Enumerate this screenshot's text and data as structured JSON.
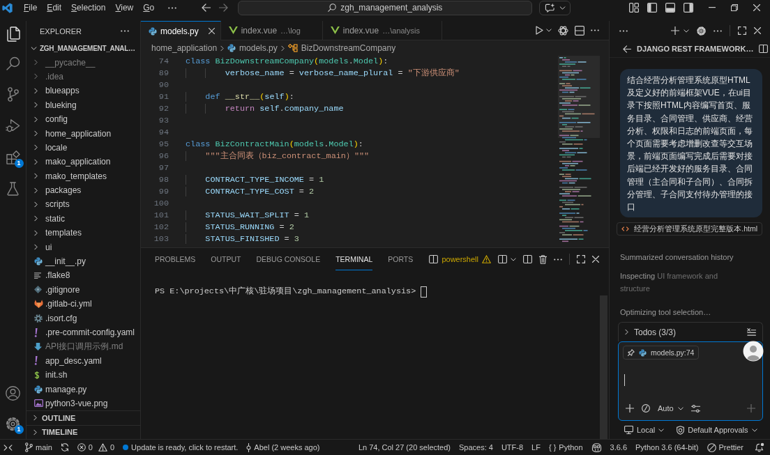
{
  "title_bar": {
    "menus": [
      "File",
      "Edit",
      "Selection",
      "View",
      "Go"
    ],
    "search": "zgh_management_analysis"
  },
  "activity_bar": {
    "items": [
      {
        "kind": "explorer",
        "selected": true
      },
      {
        "kind": "search",
        "selected": false
      },
      {
        "kind": "source_control",
        "selected": false
      },
      {
        "kind": "run_debug",
        "selected": false
      },
      {
        "kind": "extensions",
        "selected": false,
        "badge": "1"
      },
      {
        "kind": "testing",
        "selected": false
      }
    ],
    "bottom": [
      {
        "kind": "accounts"
      },
      {
        "kind": "manage",
        "badge": "1"
      }
    ]
  },
  "explorer": {
    "title": "EXPLORER",
    "root": {
      "name": "ZGH_MANAGEMENT_ANAL…",
      "expanded": true,
      "children": [
        {
          "name": "__pycache__",
          "kind": "folder",
          "expanded": false,
          "dimmed": true
        },
        {
          "name": ".idea",
          "kind": "folder",
          "expanded": false,
          "dimmed": true
        },
        {
          "name": "blueapps",
          "kind": "folder",
          "expanded": false,
          "dimmed": false
        },
        {
          "name": "blueking",
          "kind": "folder",
          "expanded": false,
          "dimmed": false
        },
        {
          "name": "config",
          "kind": "folder",
          "expanded": false,
          "dimmed": false
        },
        {
          "name": "home_application",
          "kind": "folder",
          "expanded": false,
          "dimmed": false
        },
        {
          "name": "locale",
          "kind": "folder",
          "expanded": false,
          "dimmed": false
        },
        {
          "name": "mako_application",
          "kind": "folder",
          "expanded": false,
          "dimmed": false
        },
        {
          "name": "mako_templates",
          "kind": "folder",
          "expanded": false,
          "dimmed": false
        },
        {
          "name": "packages",
          "kind": "folder",
          "expanded": false,
          "dimmed": false
        },
        {
          "name": "scripts",
          "kind": "folder",
          "expanded": false,
          "dimmed": false
        },
        {
          "name": "static",
          "kind": "folder",
          "expanded": false,
          "dimmed": false
        },
        {
          "name": "templates",
          "kind": "folder",
          "expanded": false,
          "dimmed": false
        },
        {
          "name": "ui",
          "kind": "folder",
          "expanded": false,
          "dimmed": false
        },
        {
          "name": "__init__.py",
          "kind": "python",
          "dimmed": false
        },
        {
          "name": ".flake8",
          "kind": "lines",
          "dimmed": false
        },
        {
          "name": ".gitignore",
          "kind": "git",
          "dimmed": false
        },
        {
          "name": ".gitlab-ci.yml",
          "kind": "gitlab",
          "dimmed": false
        },
        {
          "name": ".isort.cfg",
          "kind": "config",
          "dimmed": false
        },
        {
          "name": ".pre-commit-config.yaml",
          "kind": "yaml",
          "dimmed": false
        },
        {
          "name": "API接口调用示例.md",
          "kind": "markdown",
          "dimmed": true
        },
        {
          "name": "app_desc.yaml",
          "kind": "yaml",
          "dimmed": false
        },
        {
          "name": "init.sh",
          "kind": "shell",
          "dimmed": false
        },
        {
          "name": "manage.py",
          "kind": "python",
          "dimmed": false
        },
        {
          "name": "python3-vue.png",
          "kind": "image",
          "dimmed": false
        }
      ]
    },
    "sections": [
      {
        "name": "OUTLINE",
        "expanded": false
      },
      {
        "name": "TIMELINE",
        "expanded": false
      }
    ]
  },
  "editor": {
    "tabs": [
      {
        "label": "models.py",
        "kind": "python",
        "selected": true
      },
      {
        "label": "index.vue",
        "description": "…\\log",
        "kind": "vue",
        "selected": false
      },
      {
        "label": "index.vue",
        "description": "…\\analysis",
        "kind": "vue",
        "selected": false
      }
    ],
    "breadcrumbs": [
      {
        "label": "home_application",
        "kind": "folder"
      },
      {
        "label": "models.py",
        "kind": "python"
      },
      {
        "label": "BizDownstreamCompany",
        "kind": "class"
      }
    ],
    "lines": [
      {
        "number": "74",
        "tokens": [
          {
            "text": "class ",
            "kind": "keyword"
          },
          {
            "text": "BizDownstreamCompany",
            "kind": "type"
          },
          {
            "text": "(",
            "kind": "bracket"
          },
          {
            "text": "models",
            "kind": "type"
          },
          {
            "text": ".",
            "kind": "plain"
          },
          {
            "text": "Model",
            "kind": "type"
          },
          {
            "text": ")",
            "kind": "bracket"
          },
          {
            "text": ":",
            "kind": "plain"
          }
        ]
      },
      {
        "number": "89",
        "tokens": [
          {
            "text": "        verbose_name",
            "kind": "variable"
          },
          {
            "text": " = ",
            "kind": "plain"
          },
          {
            "text": "verbose_name_plural",
            "kind": "variable"
          },
          {
            "text": " = ",
            "kind": "plain"
          },
          {
            "text": "\"下游供应商\"",
            "kind": "string"
          }
        ]
      },
      {
        "number": "90"
      },
      {
        "number": "91",
        "tokens": [
          {
            "text": "    def ",
            "kind": "keyword"
          },
          {
            "text": "__str__",
            "kind": "function"
          },
          {
            "text": "(",
            "kind": "bracket"
          },
          {
            "text": "self",
            "kind": "variable"
          },
          {
            "text": ")",
            "kind": "bracket"
          },
          {
            "text": ":",
            "kind": "plain"
          }
        ]
      },
      {
        "number": "92",
        "tokens": [
          {
            "text": "        return ",
            "kind": "control"
          },
          {
            "text": "self",
            "kind": "variable"
          },
          {
            "text": ".",
            "kind": "plain"
          },
          {
            "text": "company_name",
            "kind": "variable"
          }
        ]
      },
      {
        "number": "93"
      },
      {
        "number": "94"
      },
      {
        "number": "95",
        "tokens": [
          {
            "text": "class ",
            "kind": "keyword"
          },
          {
            "text": "BizContractMain",
            "kind": "type"
          },
          {
            "text": "(",
            "kind": "bracket"
          },
          {
            "text": "models",
            "kind": "type"
          },
          {
            "text": ".",
            "kind": "plain"
          },
          {
            "text": "Model",
            "kind": "type"
          },
          {
            "text": ")",
            "kind": "bracket"
          },
          {
            "text": ":",
            "kind": "plain"
          }
        ]
      },
      {
        "number": "96",
        "tokens": [
          {
            "text": "    \"\"\"主合同表（biz_contract_main）\"\"\"",
            "kind": "string"
          }
        ]
      },
      {
        "number": "97"
      },
      {
        "number": "98",
        "tokens": [
          {
            "text": "    CONTRACT_TYPE_INCOME",
            "kind": "variable"
          },
          {
            "text": " = ",
            "kind": "plain"
          },
          {
            "text": "1",
            "kind": "number"
          }
        ]
      },
      {
        "number": "99",
        "tokens": [
          {
            "text": "    CONTRACT_TYPE_COST",
            "kind": "variable"
          },
          {
            "text": " = ",
            "kind": "plain"
          },
          {
            "text": "2",
            "kind": "number"
          }
        ]
      },
      {
        "number": "100"
      },
      {
        "number": "101",
        "tokens": [
          {
            "text": "    STATUS_WAIT_SPLIT",
            "kind": "variable"
          },
          {
            "text": " = ",
            "kind": "plain"
          },
          {
            "text": "1",
            "kind": "number"
          }
        ]
      },
      {
        "number": "102",
        "tokens": [
          {
            "text": "    STATUS_RUNNING",
            "kind": "variable"
          },
          {
            "text": " = ",
            "kind": "plain"
          },
          {
            "text": "2",
            "kind": "number"
          }
        ]
      },
      {
        "number": "103",
        "tokens": [
          {
            "text": "    STATUS_FINISHED",
            "kind": "variable"
          },
          {
            "text": " = ",
            "kind": "plain"
          },
          {
            "text": "3",
            "kind": "number"
          }
        ]
      }
    ]
  },
  "panel": {
    "tabs": [
      {
        "label": "PROBLEMS",
        "selected": false
      },
      {
        "label": "OUTPUT",
        "selected": false
      },
      {
        "label": "DEBUG CONSOLE",
        "selected": false
      },
      {
        "label": "TERMINAL",
        "selected": true
      },
      {
        "label": "PORTS",
        "selected": false
      }
    ],
    "terminal": {
      "shell": "powershell",
      "warning": true,
      "prompt": "PS E:\\projects\\中广核\\驻场项目\\zgh_management_analysis>"
    }
  },
  "chat": {
    "title": "DJANGO REST FRAMEWORK…",
    "message": "结合经营分析管理系统原型HTML及定义好的前端框架VUE，在ui目录下按照HTML内容编写首页、服务目录、合同管理、供应商、经营分析、权限和日志的前端页面，每个页面需要考虑增删改查等交互场景，前端页面编写完成后需要对接后端已经开发好的服务目录、合同管理（主合同和子合同）、合同拆分管理、子合同支付待办管理的接口",
    "attachment": "经营分析管理系统原型完整版本.html",
    "progress": [
      {
        "text": "Summarized conversation history"
      },
      {
        "text": "Inspecting",
        "detail": "UI framework and structure"
      },
      {
        "text": "Optimizing tool selection…"
      }
    ],
    "todos": {
      "label": "Todos (3/3)",
      "expanded": false
    },
    "input": {
      "context": "models.py:74",
      "mode": "Auto"
    },
    "footer": [
      {
        "kind": "local",
        "label": "Local"
      },
      {
        "kind": "approvals",
        "label": "Default Approvals"
      }
    ]
  },
  "status_bar": {
    "left": [
      {
        "kind": "remote"
      },
      {
        "kind": "branch",
        "label": "main"
      },
      {
        "kind": "sync"
      },
      {
        "kind": "problems",
        "errors": "0",
        "warnings": "0"
      },
      {
        "kind": "update",
        "label": "Update is ready, click to restart."
      },
      {
        "kind": "blame",
        "label": "Abel (2 weeks ago)"
      }
    ],
    "right": [
      {
        "kind": "text",
        "label": "Ln 74, Col 27 (20 selected)"
      },
      {
        "kind": "text",
        "label": "Spaces: 4"
      },
      {
        "kind": "text",
        "label": "UTF-8"
      },
      {
        "kind": "text",
        "label": "LF"
      },
      {
        "kind": "language",
        "glyph": "{ }",
        "label": "Python"
      },
      {
        "kind": "copilot"
      },
      {
        "kind": "text",
        "label": "3.6.6"
      },
      {
        "kind": "text",
        "label": "Python 3.6 (64-bit)"
      },
      {
        "kind": "formatter",
        "label": "Prettier"
      },
      {
        "kind": "notifications"
      }
    ]
  }
}
